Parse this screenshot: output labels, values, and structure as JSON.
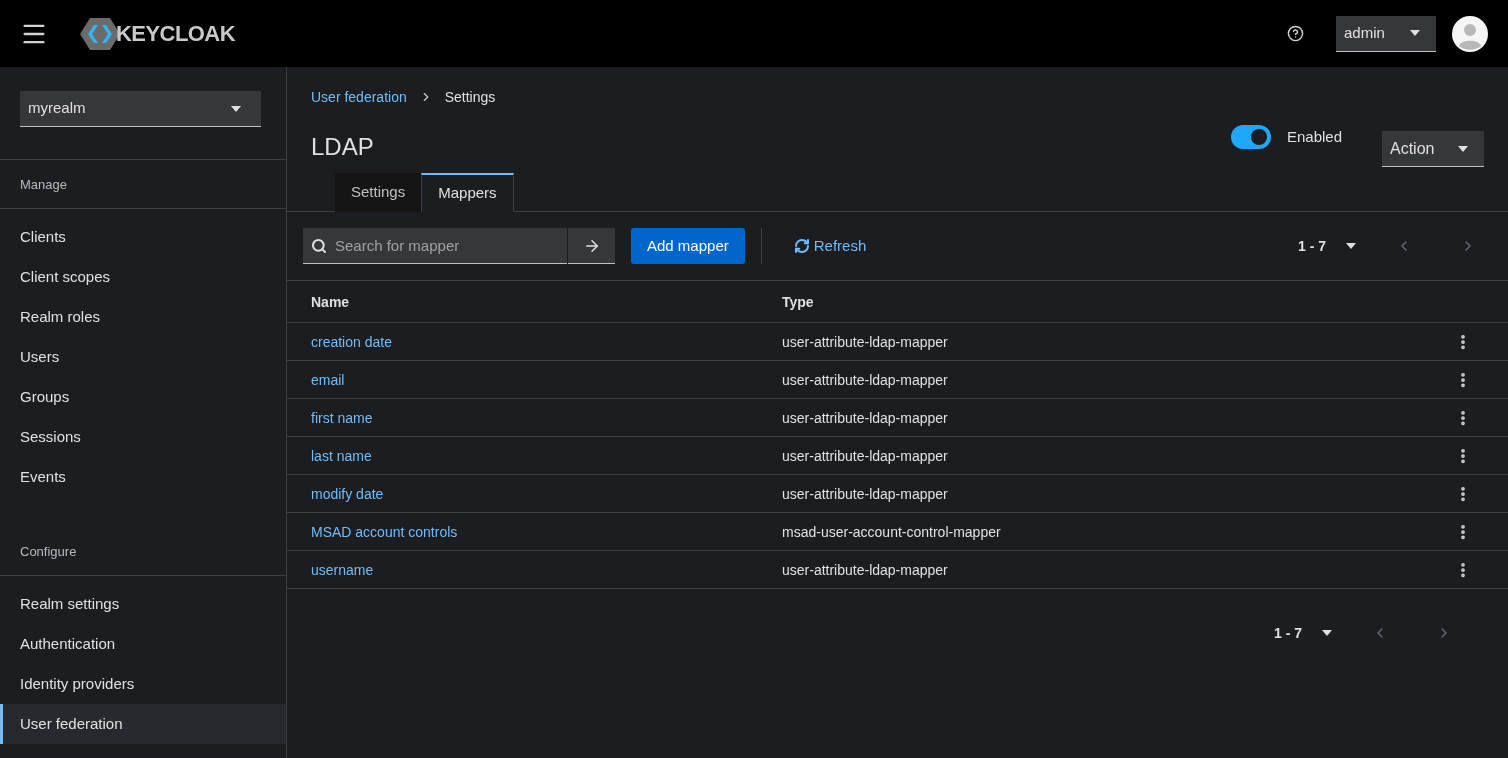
{
  "header": {
    "brand": "KEYCLOAK",
    "user": "admin"
  },
  "sidebar": {
    "realm": "myrealm",
    "sections": [
      {
        "heading": "Manage",
        "items": [
          {
            "label": "Clients",
            "selected": false
          },
          {
            "label": "Client scopes",
            "selected": false
          },
          {
            "label": "Realm roles",
            "selected": false
          },
          {
            "label": "Users",
            "selected": false
          },
          {
            "label": "Groups",
            "selected": false
          },
          {
            "label": "Sessions",
            "selected": false
          },
          {
            "label": "Events",
            "selected": false
          }
        ]
      },
      {
        "heading": "Configure",
        "items": [
          {
            "label": "Realm settings",
            "selected": false
          },
          {
            "label": "Authentication",
            "selected": false
          },
          {
            "label": "Identity providers",
            "selected": false
          },
          {
            "label": "User federation",
            "selected": true
          }
        ]
      }
    ]
  },
  "breadcrumb": [
    {
      "label": "User federation",
      "link": true
    },
    {
      "label": "Settings",
      "link": false
    }
  ],
  "title": "LDAP",
  "enabled": {
    "label": "Enabled",
    "on": true
  },
  "action": "Action",
  "tabs": [
    {
      "label": "Settings",
      "selected": false
    },
    {
      "label": "Mappers",
      "selected": true
    }
  ],
  "toolbar": {
    "placeholder": "Search for mapper",
    "add": "Add mapper",
    "refresh": "Refresh",
    "range": "1 - 7"
  },
  "table": {
    "columns": [
      "Name",
      "Type"
    ],
    "rows": [
      {
        "name": "creation date",
        "type": "user-attribute-ldap-mapper"
      },
      {
        "name": "email",
        "type": "user-attribute-ldap-mapper"
      },
      {
        "name": "first name",
        "type": "user-attribute-ldap-mapper"
      },
      {
        "name": "last name",
        "type": "user-attribute-ldap-mapper"
      },
      {
        "name": "modify date",
        "type": "user-attribute-ldap-mapper"
      },
      {
        "name": "MSAD account controls",
        "type": "msad-user-account-control-mapper"
      },
      {
        "name": "username",
        "type": "user-attribute-ldap-mapper"
      }
    ]
  },
  "footer": {
    "range": "1 - 7"
  }
}
